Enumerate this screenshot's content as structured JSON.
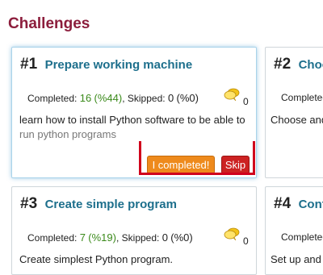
{
  "page": {
    "title": "Challenges"
  },
  "colors": {
    "title": "#8c1d3c",
    "link": "#1d6f8c",
    "completed_green": "#3b8a1b",
    "complete_button": "#ee8a1c",
    "skip_button": "#cc2222",
    "highlight": "#d0001c"
  },
  "cards": [
    {
      "number": "#1",
      "title": "Prepare working machine",
      "completed_label": "Completed:",
      "completed_count": "16",
      "completed_pct": "(%44)",
      "skipped_label": ", Skipped:",
      "skipped_count": "0",
      "skipped_pct": "(%0)",
      "comments": "0",
      "desc_line1": "learn how to install Python software to be able to",
      "desc_line2": "run python programs",
      "complete_button": "I completed!",
      "skip_button": "Skip"
    },
    {
      "number": "#2",
      "title": "Choo",
      "completed_label": "Completed:",
      "desc_line1": "Choose and"
    },
    {
      "number": "#3",
      "title": "Create simple program",
      "completed_label": "Completed:",
      "completed_count": "7",
      "completed_pct": "(%19)",
      "skipped_label": ", Skipped:",
      "skipped_count": "0",
      "skipped_pct": "(%0)",
      "comments": "0",
      "desc_line1": "Create simplest Python program."
    },
    {
      "number": "#4",
      "title": "Conf",
      "completed_label": "Completed:",
      "desc_line1": "Set up and"
    }
  ],
  "icons": {
    "comment": "speech-bubbles-icon"
  }
}
